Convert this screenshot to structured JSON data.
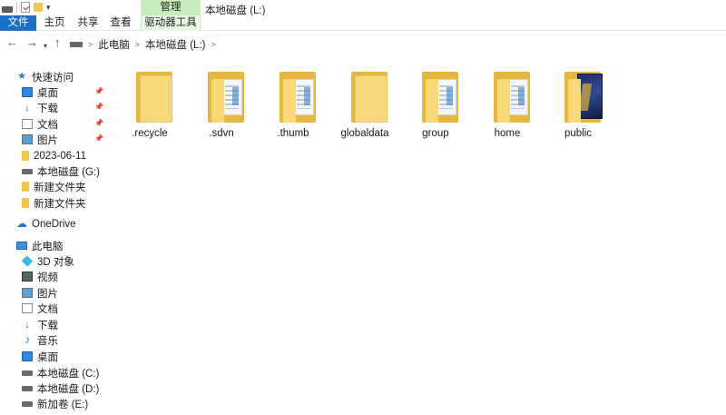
{
  "window": {
    "title": "本地磁盘 (L:)",
    "context_group": "管理"
  },
  "ribbon": {
    "tabs": {
      "file": "文件",
      "home": "主页",
      "share": "共享",
      "view": "查看",
      "drive_tools": "驱动器工具"
    },
    "accent_color": "#1a6fc7"
  },
  "address": {
    "crumb1": "此电脑",
    "crumb2": "本地磁盘 (L:)",
    "sep": ">"
  },
  "sidebar": {
    "quick_access": "快速访问",
    "desktop": "桌面",
    "downloads": "下载",
    "documents": "文档",
    "pictures": "图片",
    "folder_date": "2023-06-11",
    "drive_g": "本地磁盘 (G:)",
    "new_folder_1": "新建文件夹",
    "new_folder_2": "新建文件夹",
    "onedrive": "OneDrive",
    "this_pc": "此电脑",
    "objects_3d": "3D 对象",
    "videos": "视频",
    "pc_pictures": "图片",
    "pc_documents": "文档",
    "pc_downloads": "下载",
    "music": "音乐",
    "pc_desktop": "桌面",
    "drive_c": "本地磁盘 (C:)",
    "drive_d": "本地磁盘 (D:)",
    "drive_e": "新加卷 (E:)"
  },
  "files": {
    "recycle": ".recycle",
    "sdvn": ".sdvn",
    "thumb": ".thumb",
    "globaldata": "globaldata",
    "group": "group",
    "home": "home",
    "public": "public"
  }
}
